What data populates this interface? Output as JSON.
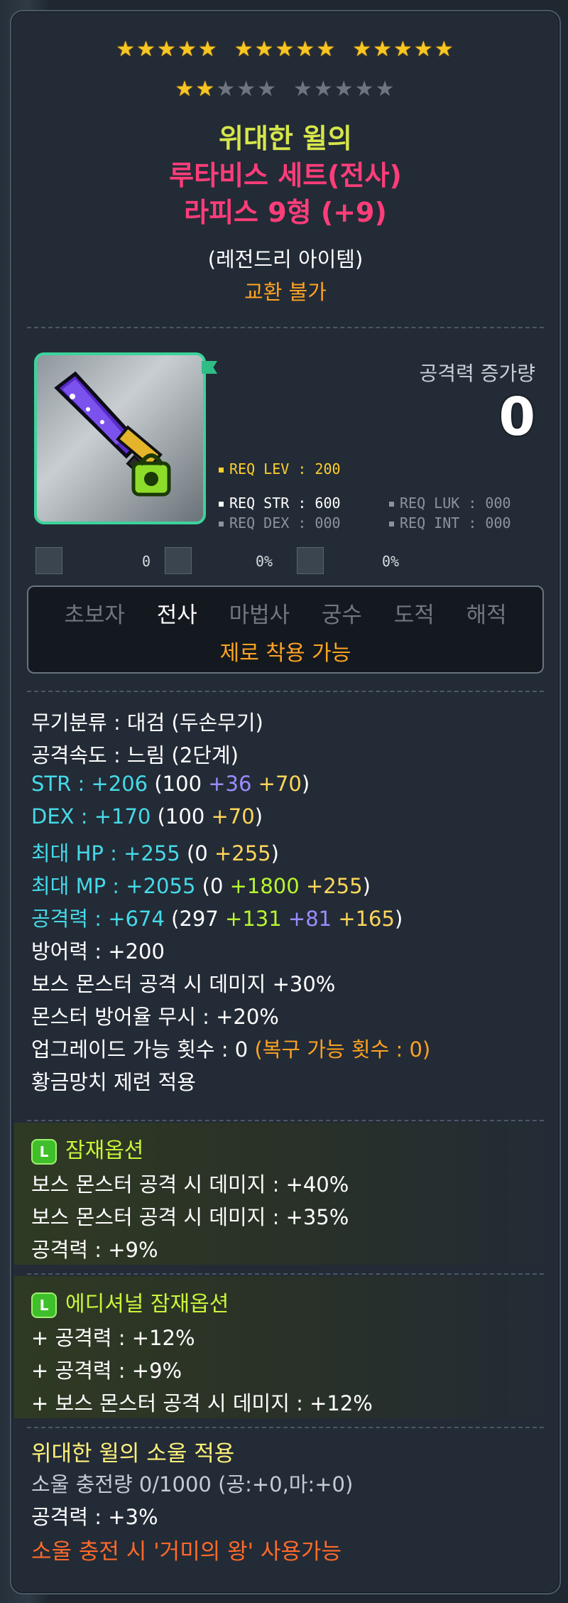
{
  "stars": {
    "row1_filled": 15,
    "row2_filled": 2,
    "row2_total": 10
  },
  "title": {
    "line1": "위대한 윌의",
    "line2": "루타비스 세트(전사)",
    "line3": "라피스 9형 (+9)",
    "grade": "(레전드리 아이템)",
    "trade": "교환 불가"
  },
  "attack_compare": {
    "label": "공격력 증가량",
    "value": "0"
  },
  "requirements": {
    "lev": "REQ LEV : 200",
    "str": "REQ STR : 600",
    "luk": "REQ LUK : 000",
    "dex": "REQ DEX : 000",
    "int": "REQ INT : 000"
  },
  "mini_stats": {
    "first": "0",
    "second": "0%",
    "third": "0%"
  },
  "jobs": {
    "list": [
      "초보자",
      "전사",
      "마법사",
      "궁수",
      "도적",
      "해적"
    ],
    "active": "전사",
    "zero_note": "제로 착용 가능"
  },
  "stats": {
    "weapon_type": "무기분류 : 대검 (두손무기)",
    "attack_speed": "공격속도 : 느림 (2단계)",
    "str": {
      "label": "STR : ",
      "total": "+206",
      "base": "(100 ",
      "upg": "+36",
      "sp": " ",
      "flame": "+70",
      "end": ")"
    },
    "dex": {
      "label": "DEX : ",
      "total": "+170",
      "base": "(100 ",
      "flame": "+70",
      "end": ")"
    },
    "hp": {
      "label": "최대 HP : ",
      "total": "+255",
      "base": "(0 ",
      "flame": "+255",
      "end": ")"
    },
    "mp": {
      "label": "최대 MP : ",
      "total": "+2055",
      "base": "(0 ",
      "star": "+1800",
      "sp": " ",
      "flame": "+255",
      "end": ")"
    },
    "atk": {
      "label": "공격력 : ",
      "total": "+674",
      "base": "(297 ",
      "star": "+131",
      "sp1": " ",
      "upg": "+81",
      "sp2": " ",
      "flame": "+165",
      "end": ")"
    },
    "def": "방어력 : +200",
    "boss": "보스 몬스터 공격 시 데미지 +30%",
    "ignore": "몬스터 방어율 무시 : +20%",
    "upgrade": {
      "text": "업그레이드 가능 횟수 : 0 ",
      "recover": "(복구 가능 횟수 : 0)"
    },
    "hammer": "황금망치 제련 적용"
  },
  "potential": {
    "badge": "L",
    "title": "잠재옵션",
    "lines": [
      "보스 몬스터 공격 시 데미지 : +40%",
      "보스 몬스터 공격 시 데미지 : +35%",
      "공격력 : +9%"
    ]
  },
  "additional": {
    "badge": "L",
    "title": "에디셔널 잠재옵션",
    "lines": [
      "+ 공격력 : +12%",
      "+ 공격력 : +9%",
      "+ 보스 몬스터 공격 시 데미지 : +12%"
    ]
  },
  "soul": {
    "title": "위대한 윌의 소울 적용",
    "charge": "소울 충전량 0/1000 (공:+0,마:+0)",
    "atk": "공격력 : +3%",
    "skill": "소울 충전 시 '거미의 왕' 사용가능"
  },
  "colors": {
    "star": "#f7c623",
    "title_yellow": "#d6e64a",
    "title_pink": "#ff3d7a",
    "orange": "#ffa322",
    "cyan": "#46d9e8",
    "potential_green": "#c9f53a"
  }
}
